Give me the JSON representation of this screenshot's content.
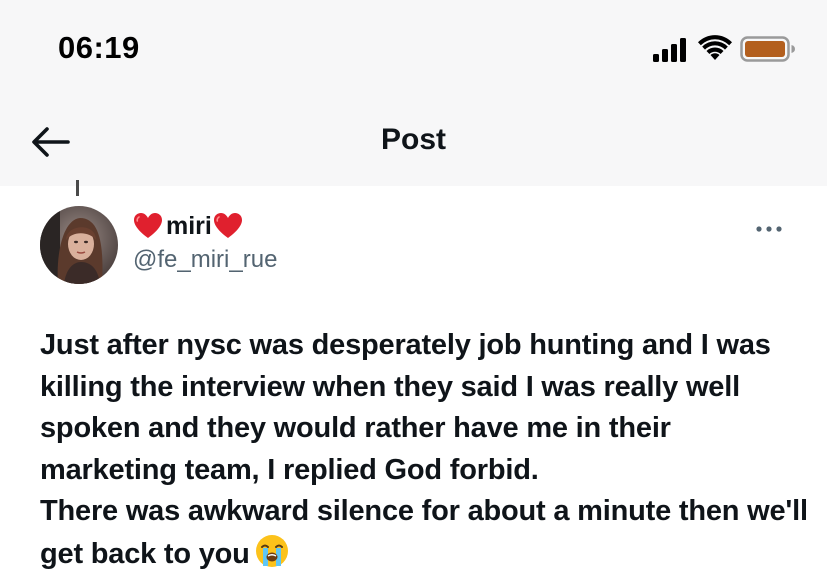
{
  "status_bar": {
    "time": "06:19",
    "battery_color": "#b35f1e"
  },
  "header": {
    "back_icon": "arrow-left-icon",
    "title": "Post"
  },
  "post": {
    "author": {
      "display_name": "miri",
      "handle": "@fe_miri_rue",
      "name_emoji": "red-heart-icon"
    },
    "more_icon": "more-horizontal-icon",
    "text_paragraph_1": "Just after nysc was desperately job hunting and I was killing the interview when they said I was really well spoken and they would rather have me in their marketing team, I replied God forbid.",
    "text_paragraph_2": "There was awkward silence for about a minute then we'll get back to you",
    "trailing_emoji": "loudly-crying-face-icon"
  },
  "colors": {
    "text_primary": "#0f1419",
    "text_secondary": "#536471",
    "header_background": "#f7f7f8",
    "heart": "#e0202e"
  }
}
